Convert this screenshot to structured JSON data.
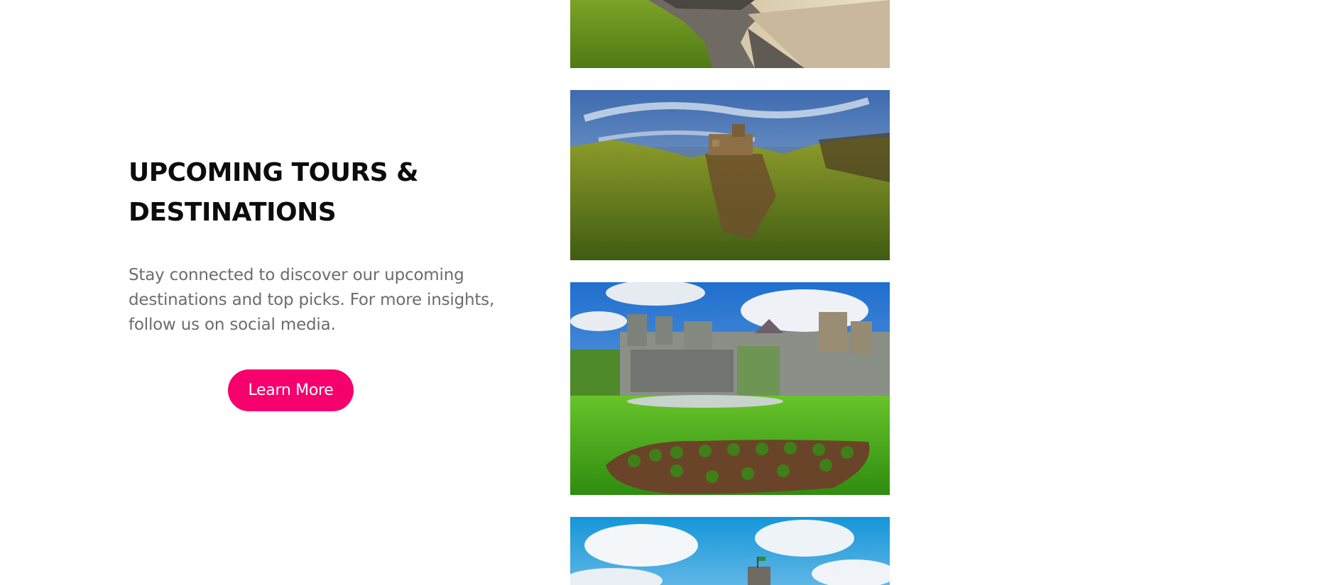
{
  "section": {
    "heading": "UPCOMING TOURS & DESTINATIONS",
    "description": "Stay connected to discover our upcoming destinations and top picks. For more insights, follow us on social media.",
    "button_label": "Learn More"
  },
  "colors": {
    "accent": "#f5006d",
    "heading_text": "#0c0c0c",
    "body_text": "#6c6c6c"
  },
  "gallery": [
    {
      "name": "coastal-rocky-shore-photo"
    },
    {
      "name": "cliffside-castle-ruins-photo"
    },
    {
      "name": "castle-with-garden-lawn-photo"
    },
    {
      "name": "castle-tower-under-sky-photo"
    }
  ]
}
